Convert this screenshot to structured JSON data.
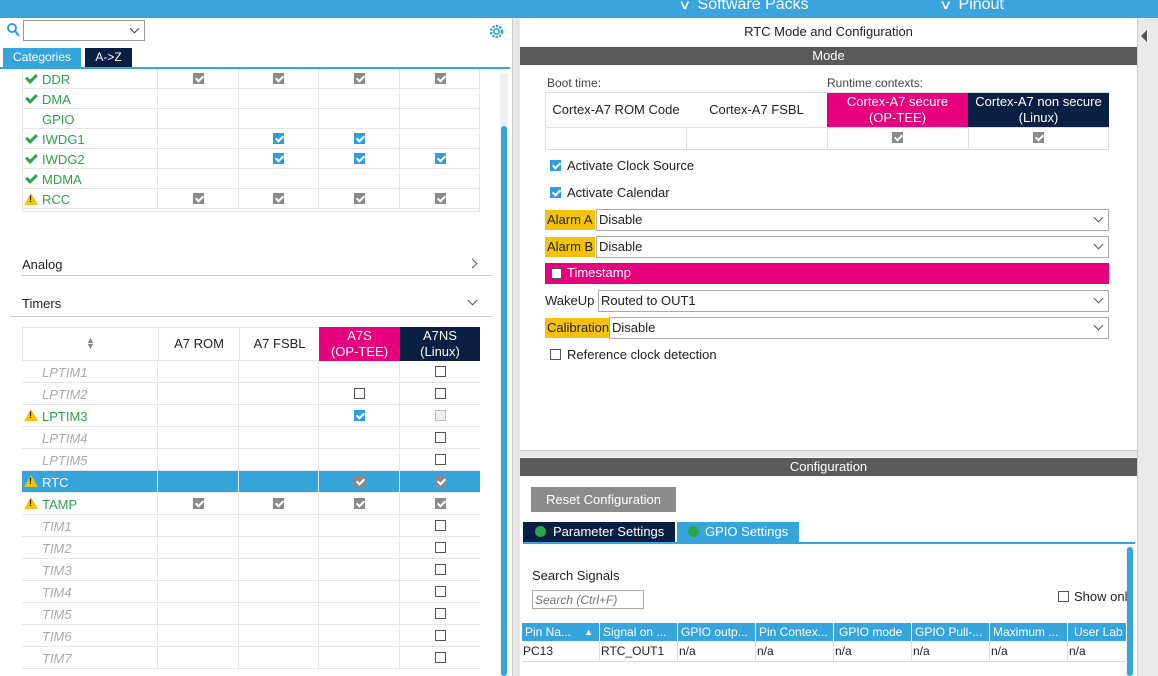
{
  "topbar": {
    "menu_software_packs": "Software Packs",
    "menu_pinout": "Pinout"
  },
  "left": {
    "search_value": "",
    "tabs": [
      "Categories",
      "A->Z"
    ],
    "system_rows": [
      {
        "name": "DDR",
        "status": "ok",
        "a7rom": "grey",
        "a7fsbl": "grey",
        "a7s": "grey",
        "a7ns": "grey"
      },
      {
        "name": "DMA",
        "status": "ok",
        "a7rom": "",
        "a7fsbl": "",
        "a7s": "",
        "a7ns": ""
      },
      {
        "name": "GPIO",
        "status": "none",
        "a7rom": "",
        "a7fsbl": "",
        "a7s": "",
        "a7ns": ""
      },
      {
        "name": "IWDG1",
        "status": "ok",
        "a7rom": "",
        "a7fsbl": "blue",
        "a7s": "blue",
        "a7ns": ""
      },
      {
        "name": "IWDG2",
        "status": "ok",
        "a7rom": "",
        "a7fsbl": "blue",
        "a7s": "blue",
        "a7ns": "blue"
      },
      {
        "name": "MDMA",
        "status": "ok",
        "a7rom": "",
        "a7fsbl": "",
        "a7s": "",
        "a7ns": ""
      },
      {
        "name": "RCC",
        "status": "warn",
        "a7rom": "grey",
        "a7fsbl": "grey",
        "a7s": "grey",
        "a7ns": "grey"
      }
    ],
    "section_analog": "Analog",
    "section_timers": "Timers",
    "timers_headers": {
      "a7rom": "A7 ROM",
      "a7fsbl": "A7 FSBL",
      "a7s": "A7S\n(OP-TEE)",
      "a7ns": "A7NS\n(Linux)"
    },
    "timer_rows": [
      {
        "name": "LPTIM1",
        "status": "disabled",
        "a7rom": "",
        "a7fsbl": "",
        "a7s": "",
        "a7ns": "empty"
      },
      {
        "name": "LPTIM2",
        "status": "disabled",
        "a7rom": "",
        "a7fsbl": "",
        "a7s": "empty",
        "a7ns": "empty"
      },
      {
        "name": "LPTIM3",
        "status": "warn",
        "a7rom": "",
        "a7fsbl": "",
        "a7s": "blue",
        "a7ns": "light"
      },
      {
        "name": "LPTIM4",
        "status": "disabled",
        "a7rom": "",
        "a7fsbl": "",
        "a7s": "",
        "a7ns": "empty"
      },
      {
        "name": "LPTIM5",
        "status": "disabled",
        "a7rom": "",
        "a7fsbl": "",
        "a7s": "",
        "a7ns": "empty"
      },
      {
        "name": "RTC",
        "status": "warn-selected",
        "a7rom": "",
        "a7fsbl": "",
        "a7s": "grey",
        "a7ns": "grey"
      },
      {
        "name": "TAMP",
        "status": "warn",
        "a7rom": "grey",
        "a7fsbl": "grey",
        "a7s": "grey",
        "a7ns": "grey"
      },
      {
        "name": "TIM1",
        "status": "disabled",
        "a7rom": "",
        "a7fsbl": "",
        "a7s": "",
        "a7ns": "empty"
      },
      {
        "name": "TIM2",
        "status": "disabled",
        "a7rom": "",
        "a7fsbl": "",
        "a7s": "",
        "a7ns": "empty"
      },
      {
        "name": "TIM3",
        "status": "disabled",
        "a7rom": "",
        "a7fsbl": "",
        "a7s": "",
        "a7ns": "empty"
      },
      {
        "name": "TIM4",
        "status": "disabled",
        "a7rom": "",
        "a7fsbl": "",
        "a7s": "",
        "a7ns": "empty"
      },
      {
        "name": "TIM5",
        "status": "disabled",
        "a7rom": "",
        "a7fsbl": "",
        "a7s": "",
        "a7ns": "empty"
      },
      {
        "name": "TIM6",
        "status": "disabled",
        "a7rom": "",
        "a7fsbl": "",
        "a7s": "",
        "a7ns": "empty"
      },
      {
        "name": "TIM7",
        "status": "disabled",
        "a7rom": "",
        "a7fsbl": "",
        "a7s": "",
        "a7ns": "empty"
      }
    ]
  },
  "right": {
    "title": "RTC Mode and Configuration",
    "mode_bar": "Mode",
    "boot_time_label": "Boot time:",
    "runtime_label": "Runtime contexts:",
    "ctx_rom": "Cortex-A7 ROM Code",
    "ctx_fsbl": "Cortex-A7 FSBL",
    "ctx_secure": "Cortex-A7 secure\n(OP-TEE)",
    "ctx_nonsecure": "Cortex-A7 non secure\n(Linux)",
    "activate_clock": "Activate Clock Source",
    "activate_calendar": "Activate Calendar",
    "alarm_a_label": "Alarm A",
    "alarm_a_value": "Disable",
    "alarm_b_label": "Alarm B",
    "alarm_b_value": "Disable",
    "timestamp_label": "Timestamp",
    "wakeup_label": "WakeUp",
    "wakeup_value": "Routed to OUT1",
    "calibration_label": "Calibration",
    "calibration_value": "Disable",
    "ref_clock_label": "Reference clock detection",
    "config_bar": "Configuration",
    "reset_button": "Reset Configuration",
    "tab_param": "Parameter Settings",
    "tab_gpio": "GPIO Settings",
    "search_signals_label": "Search Signals",
    "search_placeholder": "Search (Ctrl+F)",
    "show_only_label": "Show onl",
    "gpio_headers": [
      "Pin Na...",
      "Signal on ...",
      "GPIO outp...",
      "Pin Contex...",
      "GPIO mode",
      "GPIO Pull-...",
      "Maximum ...",
      "User Lab"
    ],
    "gpio_rows": [
      [
        "PC13",
        "RTC_OUT1",
        "n/a",
        "n/a",
        "n/a",
        "n/a",
        "n/a",
        "n/a"
      ]
    ]
  },
  "colors": {
    "accent_blue": "#35a5dc",
    "secure_pink": "#e6007e",
    "nonsecure_navy": "#0b1f45",
    "warning_yellow": "#f4c20d",
    "ok_green": "#2ca44a"
  }
}
